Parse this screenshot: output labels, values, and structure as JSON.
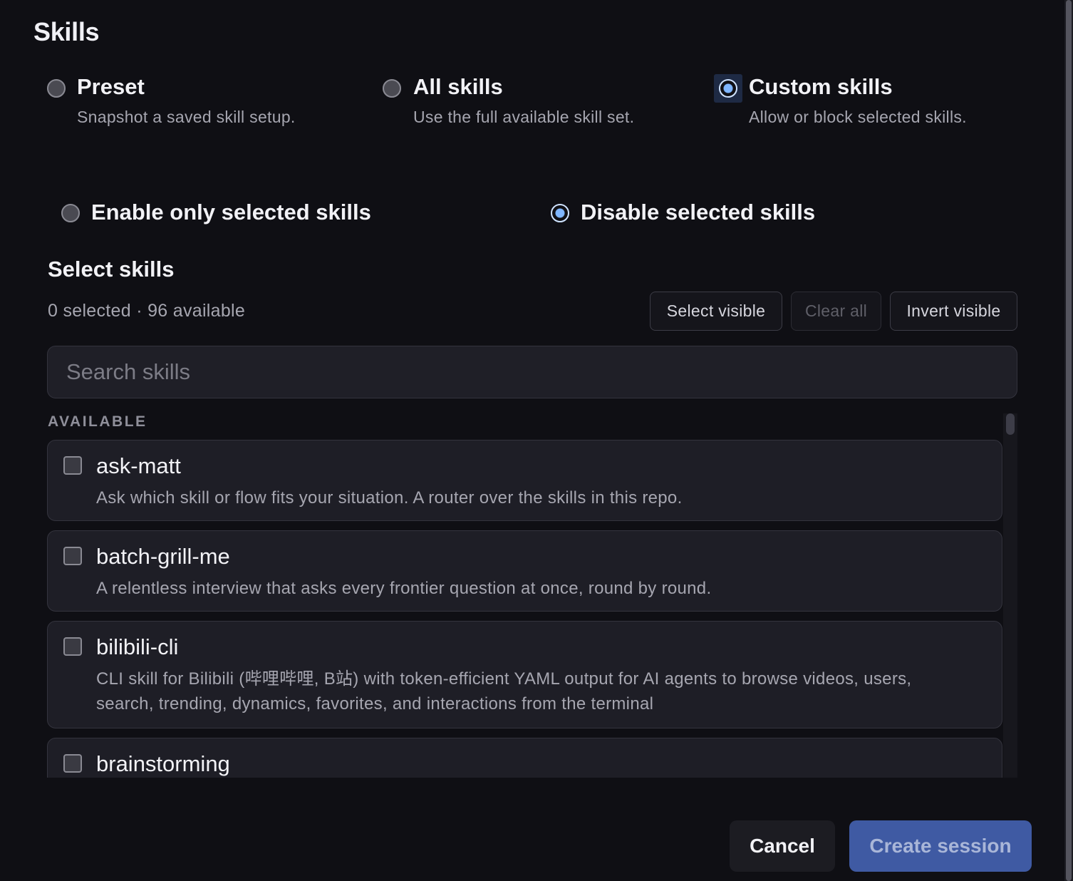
{
  "section": {
    "title": "Skills"
  },
  "modes": [
    {
      "label": "Preset",
      "desc": "Snapshot a saved skill setup.",
      "checked": false
    },
    {
      "label": "All skills",
      "desc": "Use the full available skill set.",
      "checked": false
    },
    {
      "label": "Custom skills",
      "desc": "Allow or block selected skills.",
      "checked": true
    }
  ],
  "filters": [
    {
      "label": "Enable only selected skills",
      "checked": false
    },
    {
      "label": "Disable selected skills",
      "checked": true
    }
  ],
  "select": {
    "title": "Select skills",
    "count": "0 selected · 96 available",
    "select_visible": "Select visible",
    "clear_all": "Clear all",
    "invert_visible": "Invert visible"
  },
  "search": {
    "placeholder": "Search skills",
    "value": ""
  },
  "list": {
    "heading": "AVAILABLE",
    "items": [
      {
        "name": "ask-matt",
        "desc": "Ask which skill or flow fits your situation. A router over the skills in this repo."
      },
      {
        "name": "batch-grill-me",
        "desc": "A relentless interview that asks every frontier question at once, round by round."
      },
      {
        "name": "bilibili-cli",
        "desc": "CLI skill for Bilibili (哔哩哔哩, B站) with token-efficient YAML output for AI agents to browse videos, users, search, trending, dynamics, favorites, and interactions from the terminal"
      },
      {
        "name": "brainstorming",
        "desc": ""
      }
    ]
  },
  "footer": {
    "cancel": "Cancel",
    "create": "Create session"
  },
  "colors": {
    "accent": "#3f5aa3",
    "radio_checked": "#7fb6ff",
    "background": "#0f0f14"
  }
}
